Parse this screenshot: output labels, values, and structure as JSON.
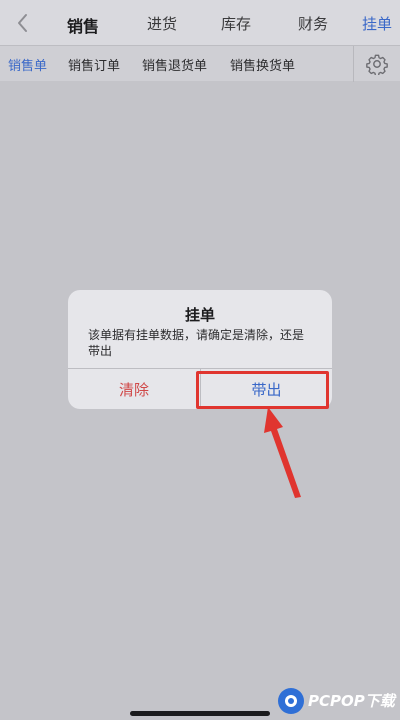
{
  "nav": {
    "back_icon": "chevron-left-icon",
    "tabs": [
      {
        "label": "销售"
      },
      {
        "label": "进货"
      },
      {
        "label": "库存"
      },
      {
        "label": "财务"
      },
      {
        "label": "挂单"
      }
    ]
  },
  "subnav": {
    "tabs": [
      {
        "label": "销售单"
      },
      {
        "label": "销售订单"
      },
      {
        "label": "销售退货单"
      },
      {
        "label": "销售换货单"
      }
    ],
    "settings_icon": "gear-icon"
  },
  "dialog": {
    "title": "挂单",
    "message": "该单据有挂单数据，请确定是清除，还是带出",
    "clear_label": "清除",
    "out_label": "带出"
  },
  "watermark": {
    "text": "PCPOP下载"
  },
  "colors": {
    "accent_blue": "#3a68c8",
    "destructive_red": "#d04848",
    "annotation_red": "#e0352f"
  }
}
